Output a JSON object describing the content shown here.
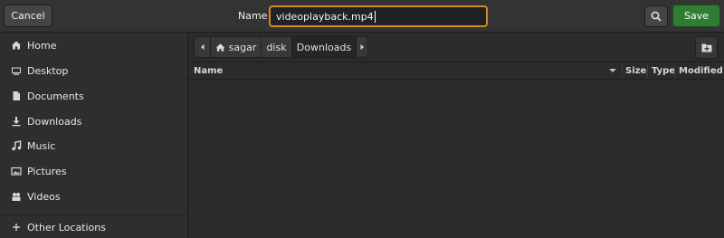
{
  "header": {
    "cancel_label": "Cancel",
    "name_label": "Name",
    "filename": "videoplayback.mp4",
    "save_label": "Save"
  },
  "sidebar": {
    "items": [
      {
        "label": "Home",
        "icon": "home-icon"
      },
      {
        "label": "Desktop",
        "icon": "desktop-icon"
      },
      {
        "label": "Documents",
        "icon": "document-icon"
      },
      {
        "label": "Downloads",
        "icon": "download-icon"
      },
      {
        "label": "Music",
        "icon": "music-icon"
      },
      {
        "label": "Pictures",
        "icon": "pictures-icon"
      },
      {
        "label": "Videos",
        "icon": "videos-icon"
      },
      {
        "label": "Other Locations",
        "icon": "plus-icon"
      }
    ]
  },
  "pathbar": {
    "crumbs": [
      "sagar",
      "disk",
      "Downloads"
    ]
  },
  "table": {
    "columns": [
      "Name",
      "Size",
      "Type",
      "Modified"
    ]
  },
  "colors": {
    "accent": "#d5891c",
    "save": "#2f7d33"
  }
}
